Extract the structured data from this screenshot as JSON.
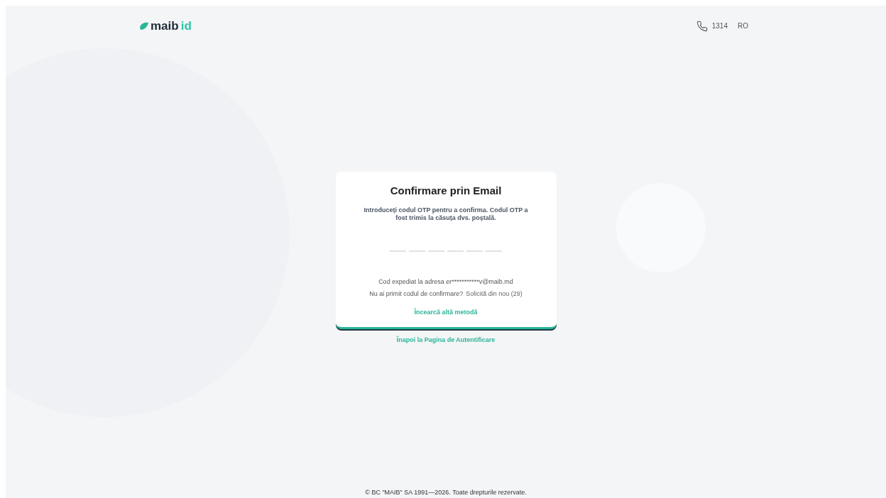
{
  "header": {
    "logo": {
      "primary": "maib",
      "secondary": "id"
    },
    "phone": "1314",
    "language": "RO"
  },
  "card": {
    "title": "Confirmare prin Email",
    "instructions": "Introduceți codul OTP pentru a confirma. Codul OTP a fost trimis la căsuța dvs. poștală.",
    "otp_slots": [
      {
        "filled": false
      },
      {
        "filled": false
      },
      {
        "filled": false
      },
      {
        "filled": false
      },
      {
        "filled": false
      },
      {
        "filled": false
      }
    ],
    "sent_to": "Cod expediat la adresa er***********v@maib.md",
    "resend_question": "Nu ai primit codul de confirmare?",
    "resend_link": {
      "label": "Solicită din nou (29)",
      "disabled": true
    },
    "other_method": "Încearcă altă metodă"
  },
  "back_link": "Înapoi la Pagina de Autentificare",
  "footer": "© BC \"MAIB\" SA 1991—2026. Toate drepturile rezervate."
}
